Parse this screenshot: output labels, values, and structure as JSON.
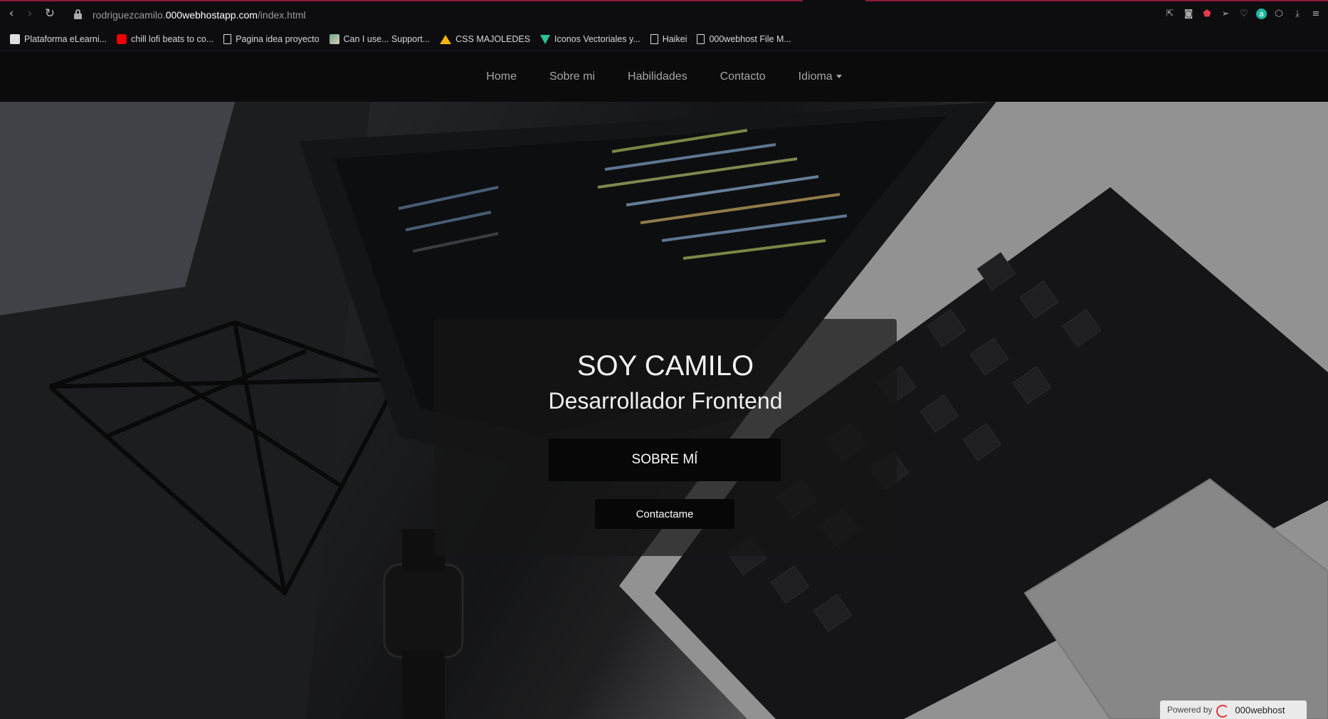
{
  "browser": {
    "url_prefix": "rodriguezcamilo.",
    "url_host": "000webhostapp.com",
    "url_path": "/index.html",
    "bookmarks": [
      {
        "label": "Plataforma eLearni...",
        "icon": "platform-icon"
      },
      {
        "label": "chill lofi beats to co...",
        "icon": "youtube-icon"
      },
      {
        "label": "Pagina idea proyecto",
        "icon": "file-icon"
      },
      {
        "label": "Can I use... Support...",
        "icon": "image-icon"
      },
      {
        "label": "CSS MAJOLEDES",
        "icon": "drive-icon"
      },
      {
        "label": "Iconos Vectoriales y...",
        "icon": "vector-icon"
      },
      {
        "label": "Haikei",
        "icon": "file-icon"
      },
      {
        "label": "000webhost File M...",
        "icon": "file-icon"
      }
    ]
  },
  "nav": {
    "items": [
      "Home",
      "Sobre mi",
      "Habilidades",
      "Contacto",
      "Idioma"
    ]
  },
  "hero": {
    "title": "SOY CAMILO",
    "subtitle": "Desarrollador Frontend",
    "about_button": "SOBRE MÍ",
    "contact_button": "Contactame"
  },
  "footer_badge": {
    "powered_by": "Powered by",
    "brand": "000webhost"
  },
  "colors": {
    "navbar_bg": "#0b0b0b",
    "nav_link": "#a6a6a6",
    "card_bg": "rgba(22,22,22,0.72)",
    "button_bg": "#070707"
  }
}
